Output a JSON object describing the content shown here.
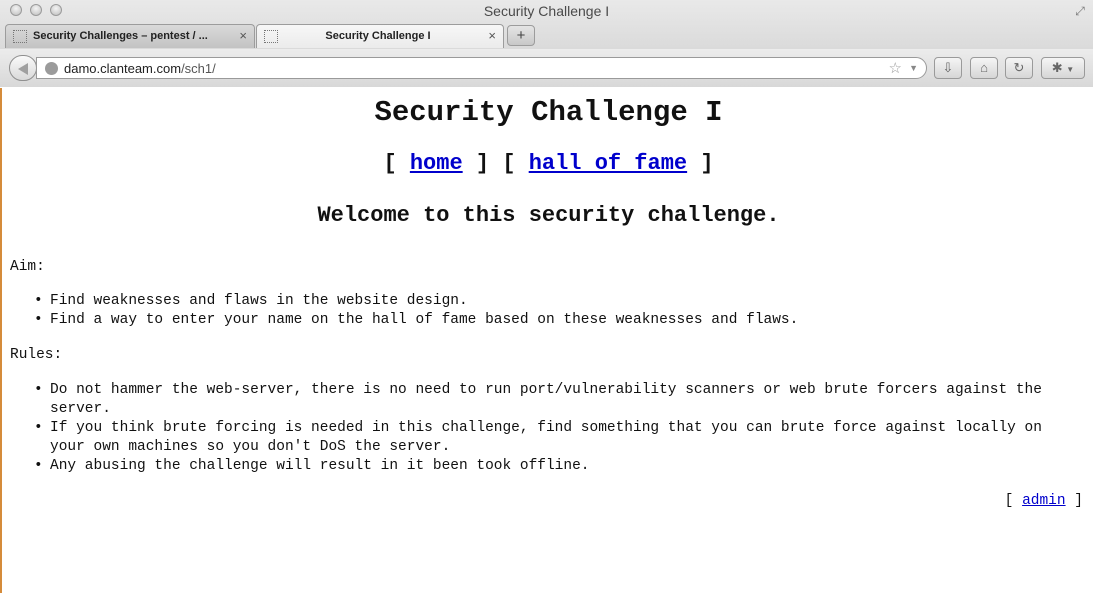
{
  "window": {
    "title": "Security Challenge I"
  },
  "tabs": [
    {
      "label": "Security Challenges – pentest / ...",
      "close": "×"
    },
    {
      "label": "Security Challenge I",
      "close": "×"
    }
  ],
  "new_tab_label": "+",
  "url": {
    "host": "damo.clanteam.com",
    "path": "/sch1/"
  },
  "page": {
    "title": "Security Challenge I",
    "nav": {
      "open1": "[ ",
      "home": "home",
      "mid": " ] [ ",
      "hall_of_fame": "hall of fame",
      "close2": " ]"
    },
    "welcome": "Welcome to this security challenge.",
    "aim_label": "Aim:",
    "aim_items": [
      "Find weaknesses and flaws in the website design.",
      "Find a way to enter your name on the hall of fame based on these weaknesses and flaws."
    ],
    "rules_label": "Rules:",
    "rules_items": [
      "Do not hammer the web-server, there is no need to run port/vulnerability scanners or web brute forcers against the server.",
      "If you think brute forcing is needed in this challenge, find something that you can brute force against locally on your own machines so you don't DoS the server.",
      "Any abusing the challenge will result in it been took offline."
    ],
    "admin": {
      "open": "[ ",
      "label": "admin",
      "close": " ]"
    }
  }
}
